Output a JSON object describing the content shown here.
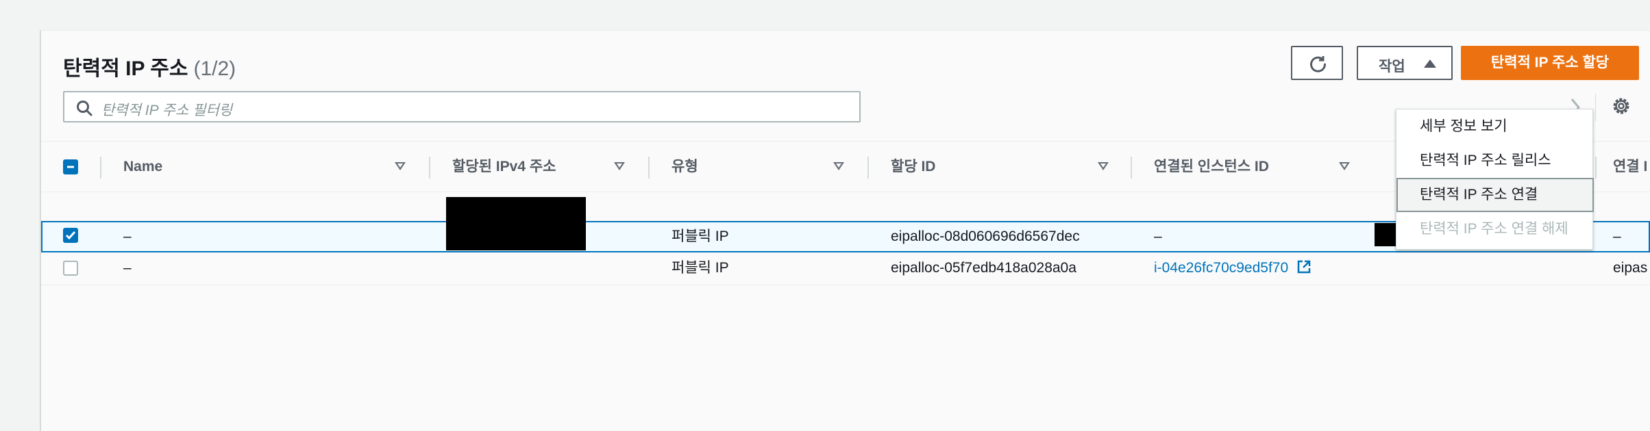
{
  "panel": {
    "title": "탄력적 IP 주소",
    "count": "(1/2)",
    "search_placeholder": "탄력적 IP 주소 필터링"
  },
  "toolbar": {
    "refresh_icon": "refresh-icon",
    "actions_label": "작업",
    "primary_label": "탄력적 IP 주소 할당",
    "primary_color": "#ec7211"
  },
  "actions_menu": {
    "items": [
      {
        "label": "세부 정보 보기",
        "state": "normal"
      },
      {
        "label": "탄력적 IP 주소 릴리스",
        "state": "normal"
      },
      {
        "label": "탄력적 IP 주소 연결",
        "state": "highlighted"
      },
      {
        "label": "탄력적 IP 주소 연결 해제",
        "state": "disabled"
      }
    ]
  },
  "table": {
    "columns": [
      "Name",
      "할당된 IPv4 주소",
      "유형",
      "할당 ID",
      "연결된 인스턴스 ID",
      "연결 I"
    ],
    "rows": [
      {
        "selected": true,
        "name": "–",
        "ipv4": "",
        "type": "퍼블릭 IP",
        "allocation_id": "eipalloc-08d060696d6567dec",
        "instance_id": "–",
        "private_ip": "",
        "association_id": "–"
      },
      {
        "selected": false,
        "name": "–",
        "ipv4": "",
        "type": "퍼블릭 IP",
        "allocation_id": "eipalloc-05f7edb418a028a0a",
        "instance_id": "i-04e26fc70c9ed5f70",
        "private_ip": "",
        "association_id": "eipas"
      }
    ]
  },
  "colors": {
    "accent_blue": "#0073bb",
    "border_dark": "#545b64"
  }
}
